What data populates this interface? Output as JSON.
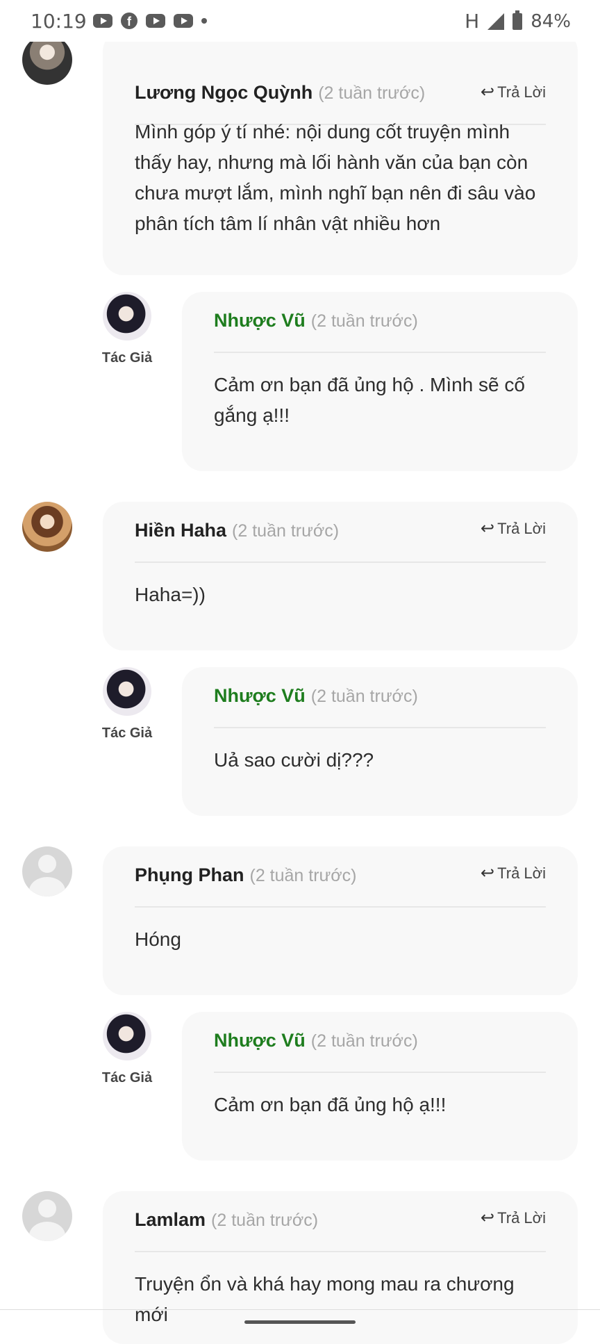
{
  "status_bar": {
    "time": "10:19",
    "network": "H",
    "battery": "84%"
  },
  "comments": [
    {
      "name": "Lương Ngọc Quỳnh",
      "time": "(2 tuần trước)",
      "reply": "Trả Lời",
      "text": "Mình góp ý tí nhé: nội dung cốt truyện mình thấy hay, nhưng mà lối hành văn của bạn còn chưa mượt lắm, mình nghĩ bạn nên đi sâu vào phân tích tâm lí nhân vật nhiều hơn",
      "author_reply": {
        "name": "Nhược Vũ",
        "time": "(2 tuần trước)",
        "tag": "Tác Giả",
        "text": "Cảm ơn bạn đã ủng hộ . Mình sẽ cố gắng ạ!!!"
      }
    },
    {
      "name": "Hiền Haha",
      "time": "(2 tuần trước)",
      "reply": "Trả Lời",
      "text": "Haha=))",
      "author_reply": {
        "name": "Nhược Vũ",
        "time": "(2 tuần trước)",
        "tag": "Tác Giả",
        "text": "Uả sao cười dị???"
      }
    },
    {
      "name": "Phụng Phan",
      "time": "(2 tuần trước)",
      "reply": "Trả Lời",
      "text": "Hóng",
      "author_reply": {
        "name": "Nhược Vũ",
        "time": "(2 tuần trước)",
        "tag": "Tác Giả",
        "text": "Cảm ơn bạn đã ủng hộ ạ!!!"
      }
    },
    {
      "name": "Lamlam",
      "time": "(2 tuần trước)",
      "reply": "Trả Lời",
      "text": "Truyện ổn và khá hay mong mau ra chương mới"
    }
  ],
  "colors": {
    "author_name": "#1e7d1e",
    "bubble_bg": "#f8f8f8",
    "time_gray": "#a6a6a6"
  }
}
